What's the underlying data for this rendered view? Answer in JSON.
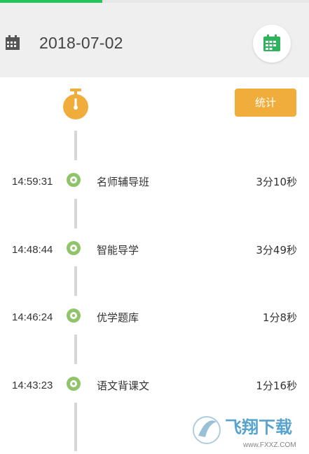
{
  "progress": {
    "fraction": 0.33,
    "color": "#28c25c"
  },
  "header": {
    "date": "2018-07-02",
    "left_icon": "calendar-icon",
    "right_icon": "calendar-grid-icon"
  },
  "stats_button": {
    "label": "统计"
  },
  "timeline": [
    {
      "time": "14:59:31",
      "app": "名师辅导班",
      "duration": "3分10秒"
    },
    {
      "time": "14:48:44",
      "app": "智能导学",
      "duration": "3分49秒"
    },
    {
      "time": "14:46:24",
      "app": "优学题库",
      "duration": "1分8秒"
    },
    {
      "time": "14:43:23",
      "app": "语文背课文",
      "duration": "1分16秒"
    }
  ],
  "colors": {
    "accent_orange": "#f0ad3c",
    "dot_green": "#8fc46a",
    "header_bg": "#efefef"
  },
  "watermark": {
    "text": "飞翔下载",
    "url_text": "www.FXXZ.COM"
  }
}
